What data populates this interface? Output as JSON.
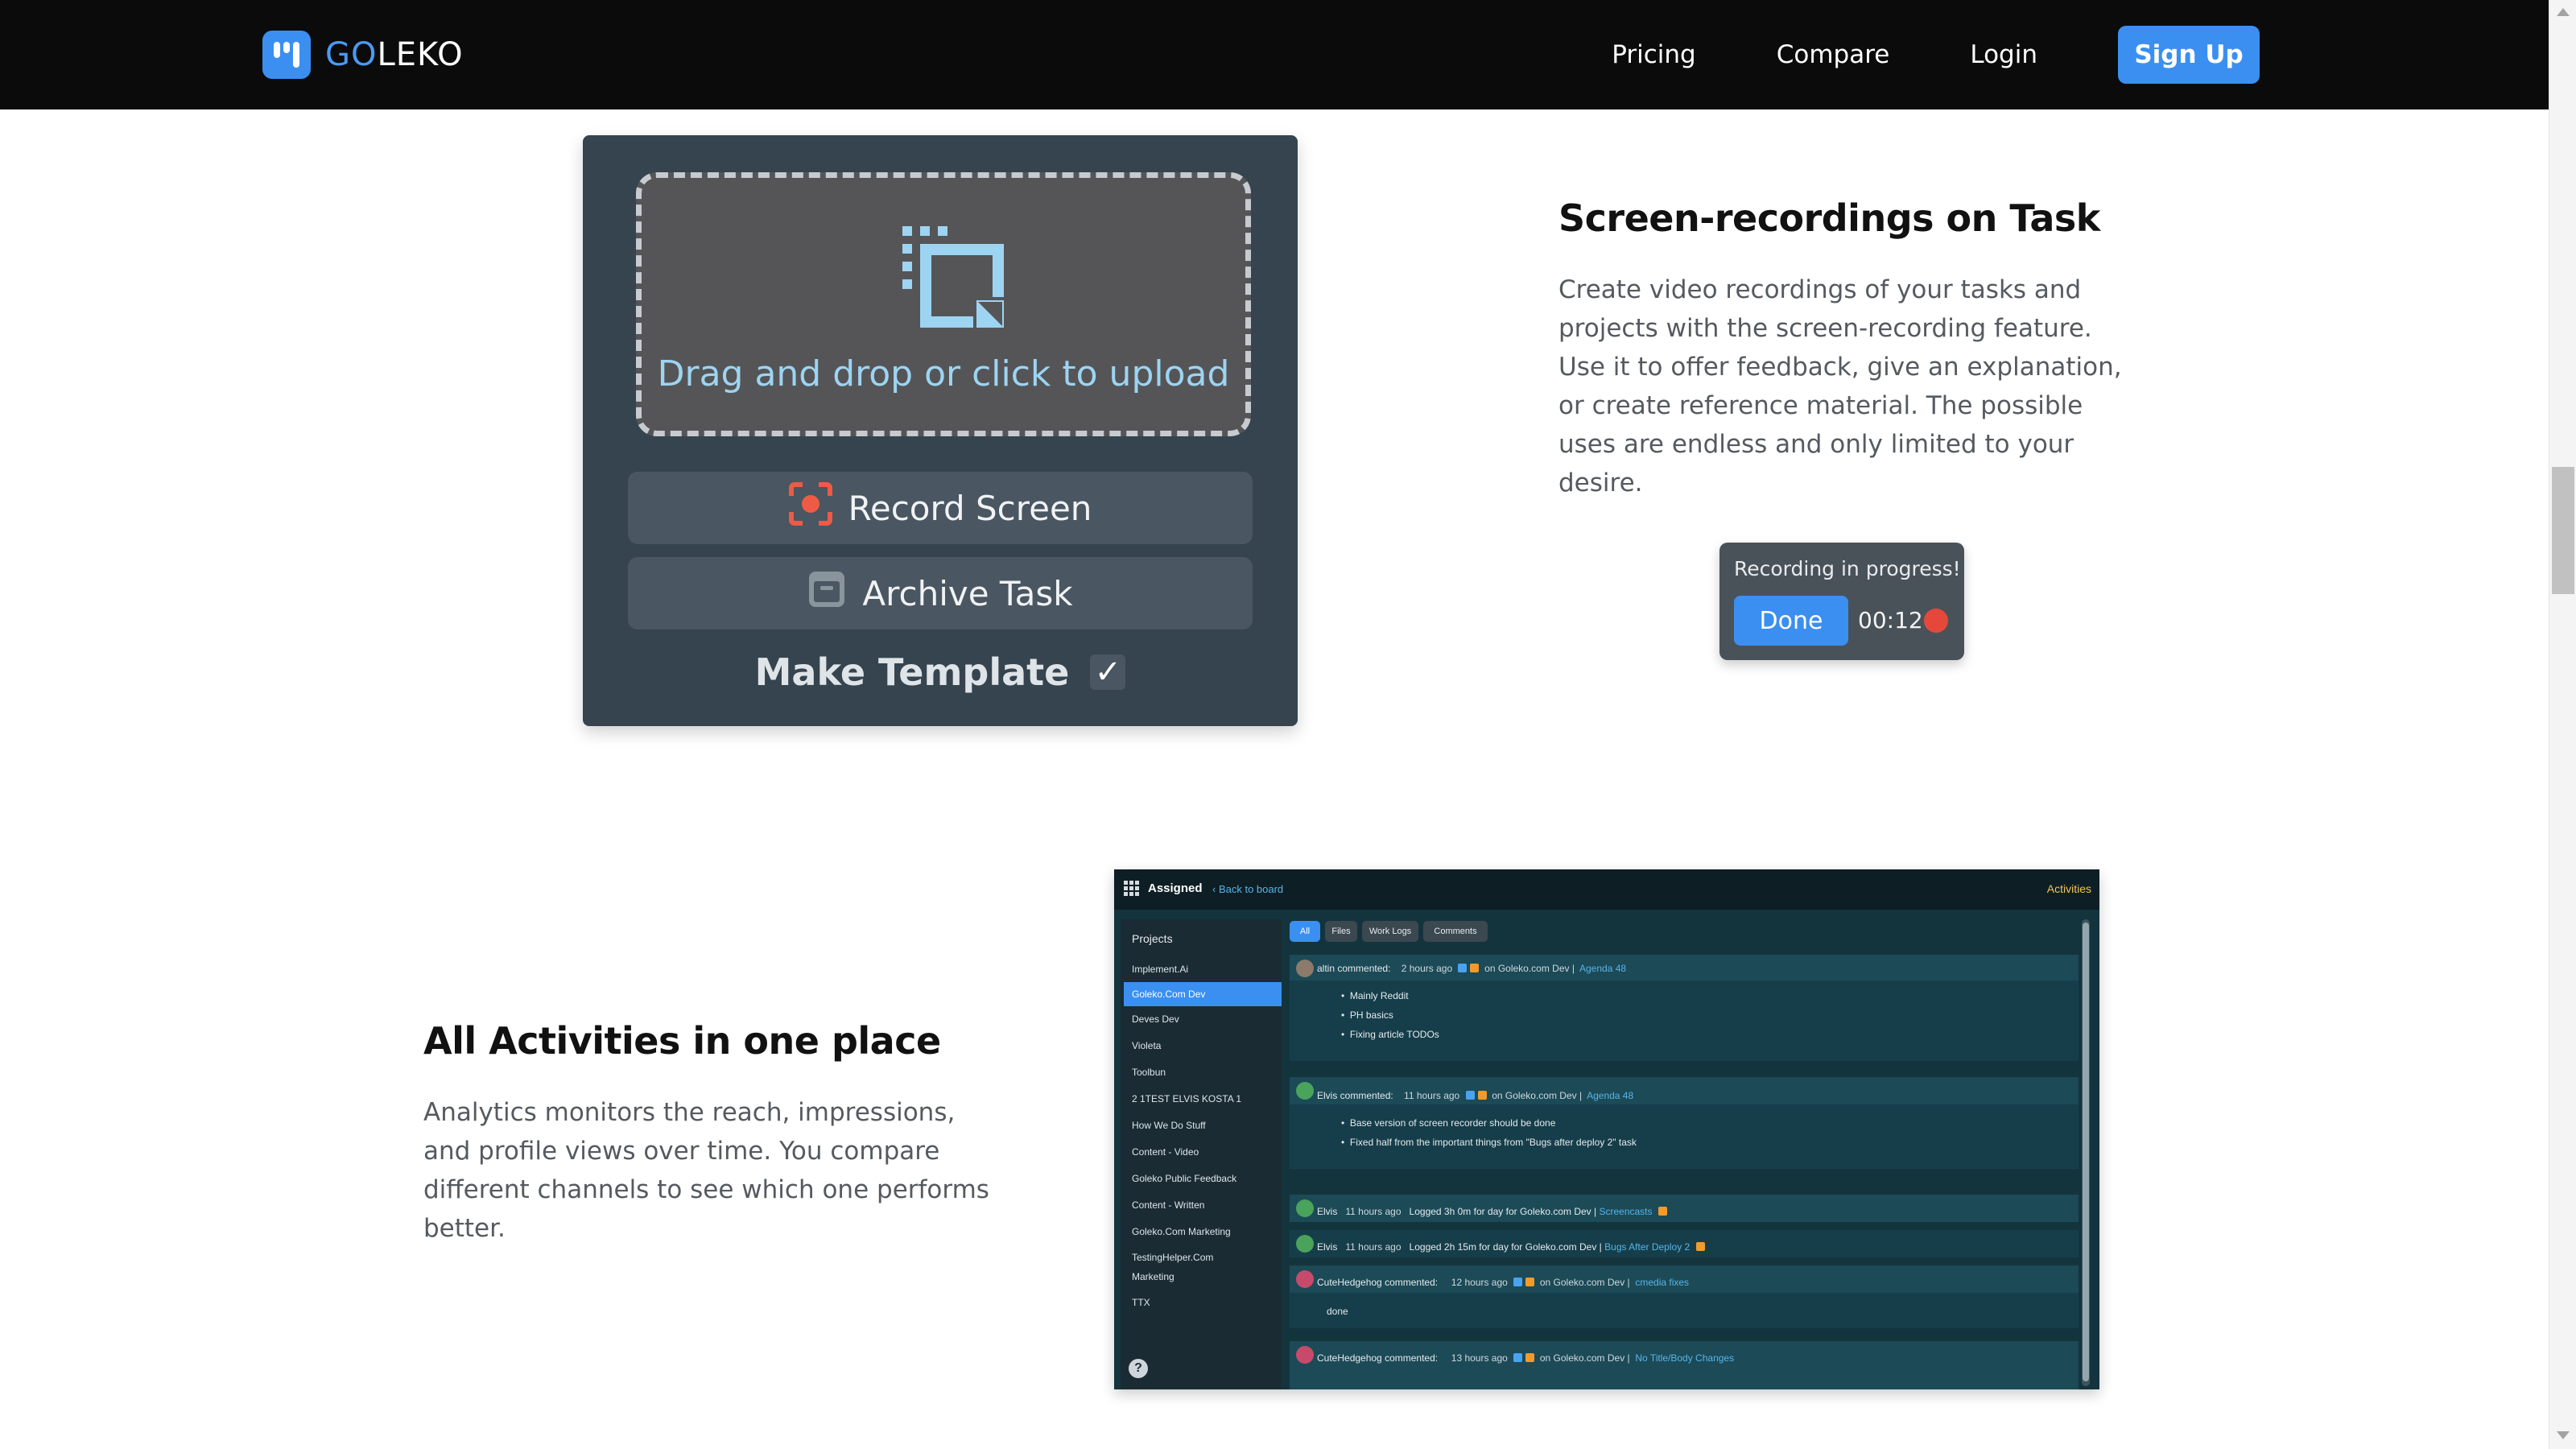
{
  "nav": {
    "logo_go": "GO",
    "logo_rest": "LEKO",
    "links": [
      "Pricing",
      "Compare",
      "Login"
    ],
    "signup": "Sign Up"
  },
  "upload": {
    "drop_text": "Drag and drop or click to upload",
    "record_screen": "Record Screen",
    "archive_task": "Archive Task",
    "make_template": "Make Template",
    "check_glyph": "✓"
  },
  "section1": {
    "title": "Screen-recordings on Task",
    "lines": [
      "Create video recordings of your tasks and",
      "projects with the screen-recording feature.",
      "Use it to offer feedback, give an explanation,",
      "or create reference material. The possible",
      "uses are endless and only limited to your",
      "desire."
    ]
  },
  "recorder": {
    "title": "Recording in progress!",
    "done": "Done",
    "time": "00:12"
  },
  "section2": {
    "title": "All Activities in one place",
    "lines": [
      "Analytics monitors the reach, impressions,",
      "and profile views over time. You compare",
      "different channels to see which one performs",
      "better."
    ]
  },
  "activities": {
    "assigned": "Assigned",
    "back": "‹ Back to board",
    "activities_label": "Activities",
    "projects_title": "Projects",
    "projects": [
      "Implement.Ai",
      "Goleko.Com Dev",
      "Deves Dev",
      "Violeta",
      "Toolbun",
      "2 1TEST ELVIS KOSTA 1",
      "How We Do Stuff",
      "Content - Video",
      "Goleko Public Feedback",
      "Content - Written",
      "Goleko.Com Marketing",
      "TestingHelper.Com",
      "Marketing",
      "TTX"
    ],
    "tabs": [
      "All",
      "Files",
      "Work Logs",
      "Comments"
    ],
    "help": "?",
    "entries": {
      "e1_head": "altin commented:",
      "e1_time": "2 hours ago",
      "e1_on": "on Goleko.com Dev |",
      "e1_link": "Agenda 48",
      "e1_b1": "Mainly Reddit",
      "e1_b2": "PH basics",
      "e1_b3": "Fixing article TODOs",
      "e2_head": "Elvis commented:",
      "e2_time": "11 hours ago",
      "e2_on": "on Goleko.com Dev |",
      "e2_link": "Agenda 48",
      "e2_b1": "Base version of screen recorder should be done",
      "e2_b2": "Fixed half from the important things from \"Bugs after deploy 2\" task",
      "e3_name": "Elvis",
      "e3_time": "11 hours ago",
      "e3_text": "Logged 3h 0m for day for Goleko.com Dev |",
      "e3_link": "Screencasts",
      "e4_name": "Elvis",
      "e4_time": "11 hours ago",
      "e4_text": "Logged 2h 15m for day for Goleko.com Dev |",
      "e4_link": "Bugs After Deploy 2",
      "e5_head": "CuteHedgehog commented:",
      "e5_time": "12 hours ago",
      "e5_on": "on Goleko.com Dev |",
      "e5_link": "cmedia fixes",
      "e5_body": "done",
      "e6_head": "CuteHedgehog commented:",
      "e6_time": "13 hours ago",
      "e6_on": "on Goleko.com Dev |",
      "e6_link": "No Title/Body Changes"
    }
  }
}
